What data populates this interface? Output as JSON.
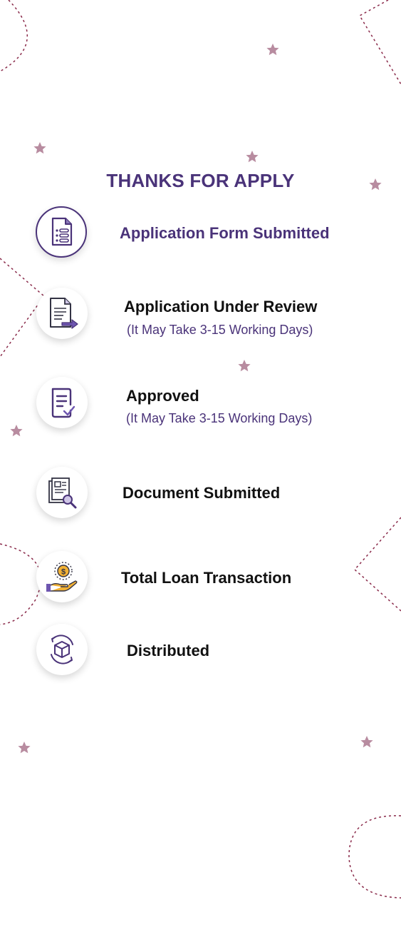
{
  "title": "THANKS FOR APPLY",
  "colors": {
    "accent": "#4a3379",
    "star": "#b88ca0",
    "dash": "#8a2a4a"
  },
  "steps": [
    {
      "label": "Application Form Submitted",
      "sub": "",
      "icon": "document-list-icon",
      "active": true
    },
    {
      "label": "Application Under Review",
      "sub": "(It May Take 3-15 Working Days)",
      "icon": "document-review-icon",
      "active": false
    },
    {
      "label": "Approved",
      "sub": "(It May Take 3-15 Working Days)",
      "icon": "document-check-icon",
      "active": false
    },
    {
      "label": "Document Submitted",
      "sub": "",
      "icon": "document-search-icon",
      "active": false
    },
    {
      "label": "Total Loan Transaction",
      "sub": "",
      "icon": "hand-coin-icon",
      "active": false
    },
    {
      "label": "Distributed",
      "sub": "",
      "icon": "box-cycle-icon",
      "active": false
    }
  ]
}
